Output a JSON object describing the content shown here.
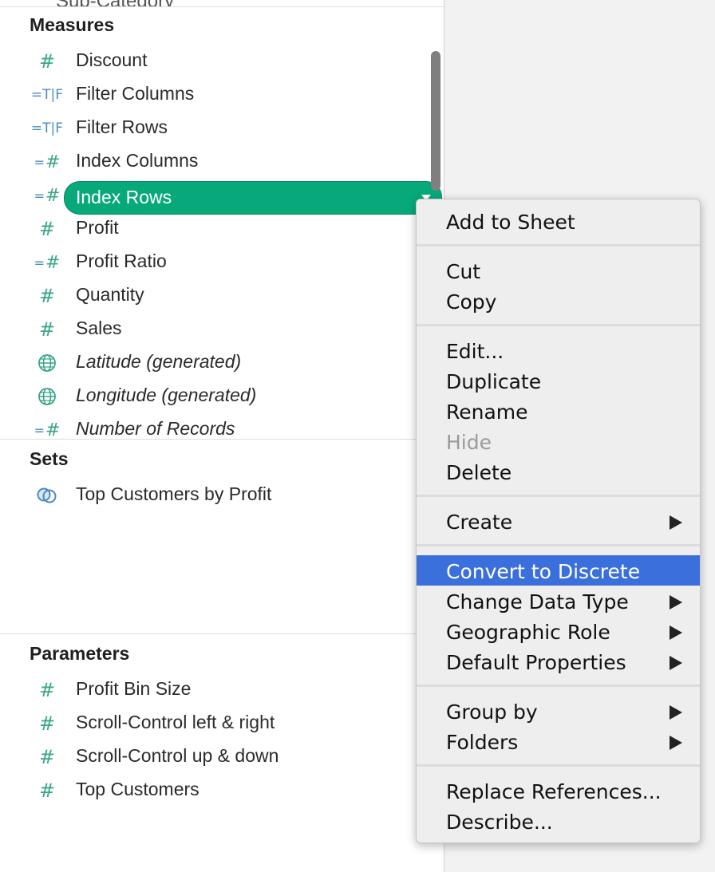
{
  "top_partial_item": "Sub-Category",
  "measures": {
    "title": "Measures",
    "items": [
      {
        "label": "Discount",
        "icon": "measure-hash-icon",
        "italic": false
      },
      {
        "label": "Filter Columns",
        "icon": "boolean-tf-icon",
        "italic": false
      },
      {
        "label": "Filter Rows",
        "icon": "boolean-tf-icon",
        "italic": false
      },
      {
        "label": "Index Columns",
        "icon": "calculated-measure-icon",
        "italic": false
      },
      {
        "label": "Index Rows",
        "icon": "calculated-measure-icon",
        "italic": false,
        "selected": true
      },
      {
        "label": "Profit",
        "icon": "measure-hash-icon",
        "italic": false
      },
      {
        "label": "Profit Ratio",
        "icon": "calculated-measure-icon",
        "italic": false
      },
      {
        "label": "Quantity",
        "icon": "measure-hash-icon",
        "italic": false
      },
      {
        "label": "Sales",
        "icon": "measure-hash-icon",
        "italic": false
      },
      {
        "label": "Latitude (generated)",
        "icon": "globe-icon",
        "italic": true
      },
      {
        "label": "Longitude (generated)",
        "icon": "globe-icon",
        "italic": true
      },
      {
        "label": "Number of Records",
        "icon": "calculated-measure-icon",
        "italic": true
      }
    ]
  },
  "sets": {
    "title": "Sets",
    "items": [
      {
        "label": "Top Customers by Profit",
        "icon": "set-icon"
      }
    ]
  },
  "parameters": {
    "title": "Parameters",
    "items": [
      {
        "label": "Profit Bin Size",
        "icon": "measure-hash-icon"
      },
      {
        "label": "Scroll-Control left & right",
        "icon": "measure-hash-icon"
      },
      {
        "label": "Scroll-Control up & down",
        "icon": "measure-hash-icon"
      },
      {
        "label": "Top Customers",
        "icon": "measure-hash-icon"
      }
    ]
  },
  "context_menu": {
    "groups": [
      [
        {
          "label": "Add to Sheet"
        }
      ],
      [
        {
          "label": "Cut"
        },
        {
          "label": "Copy"
        }
      ],
      [
        {
          "label": "Edit..."
        },
        {
          "label": "Duplicate"
        },
        {
          "label": "Rename"
        },
        {
          "label": "Hide",
          "disabled": true
        },
        {
          "label": "Delete"
        }
      ],
      [
        {
          "label": "Create",
          "submenu": true
        }
      ],
      [
        {
          "label": "Convert to Discrete",
          "highlighted": true
        },
        {
          "label": "Change Data Type",
          "submenu": true
        },
        {
          "label": "Geographic Role",
          "submenu": true
        },
        {
          "label": "Default Properties",
          "submenu": true
        }
      ],
      [
        {
          "label": "Group by",
          "submenu": true
        },
        {
          "label": "Folders",
          "submenu": true
        }
      ],
      [
        {
          "label": "Replace References..."
        },
        {
          "label": "Describe..."
        }
      ]
    ]
  },
  "colors": {
    "measure_green": "#3aa58a",
    "calc_blue": "#4a8ac0",
    "selected_pill": "#07a97a",
    "menu_highlight": "#3a6fdc"
  }
}
